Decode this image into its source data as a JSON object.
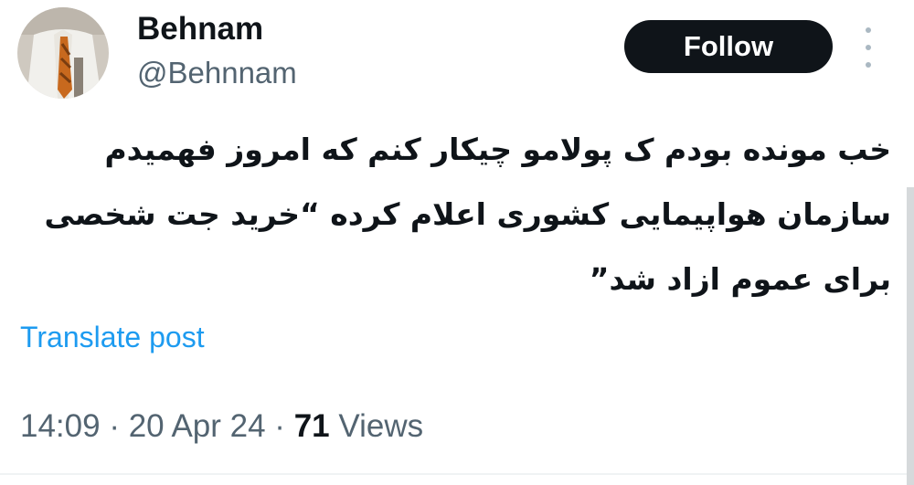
{
  "author": {
    "display_name": "Behnam",
    "handle": "@Behnnam"
  },
  "actions": {
    "follow_label": "Follow",
    "more_icon": "more-vertical-icon"
  },
  "post": {
    "text": "خب مونده بودم ک پولامو چیکار کنم که امروز فهمیدم\nسازمان هواپیمایی کشوری اعلام کرده “خرید جت شخصی\nبرای عموم ازاد شد”"
  },
  "translate_label": "Translate post",
  "meta": {
    "time": "14:09",
    "separator": "·",
    "date": "20 Apr 24",
    "views_count": "71",
    "views_label": "Views"
  },
  "colors": {
    "text_primary": "#0f1419",
    "text_secondary": "#536471",
    "link": "#1d9bf0",
    "button_bg": "#0f1419",
    "button_text": "#ffffff"
  }
}
